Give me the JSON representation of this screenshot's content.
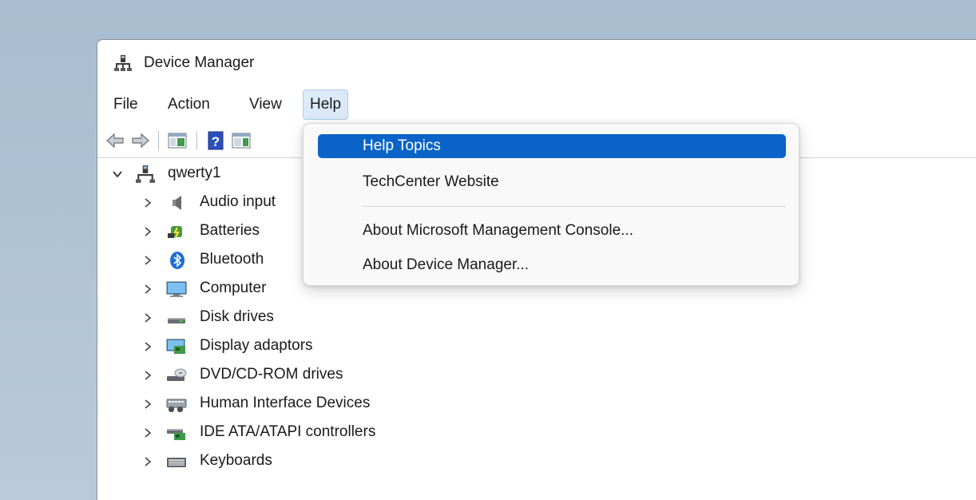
{
  "window": {
    "title": "Device Manager"
  },
  "menu": {
    "items": [
      {
        "label": "File"
      },
      {
        "label": "Action"
      },
      {
        "label": "View"
      },
      {
        "label": "Help"
      }
    ],
    "active": "Help"
  },
  "toolbar": {
    "buttons": [
      "back-icon",
      "forward-icon",
      "show-hide-console-tree-icon",
      "help-icon",
      "properties-icon"
    ]
  },
  "tree": {
    "root": {
      "label": "qwerty1",
      "icon": "computer-network-icon",
      "expanded": true
    },
    "children": [
      {
        "label": "Audio inputs and outputs",
        "visible_label": "Audio input",
        "icon": "speaker-icon"
      },
      {
        "label": "Batteries",
        "icon": "battery-icon"
      },
      {
        "label": "Bluetooth",
        "icon": "bluetooth-icon"
      },
      {
        "label": "Computer",
        "icon": "monitor-icon"
      },
      {
        "label": "Disk drives",
        "icon": "disk-drive-icon"
      },
      {
        "label": "Display adaptors",
        "icon": "display-adapter-icon"
      },
      {
        "label": "DVD/CD-ROM drives",
        "icon": "dvd-drive-icon"
      },
      {
        "label": "Human Interface Devices",
        "icon": "hid-icon"
      },
      {
        "label": "IDE ATA/ATAPI controllers",
        "icon": "ide-controller-icon"
      },
      {
        "label": "Keyboards",
        "icon": "keyboard-icon"
      }
    ]
  },
  "help_menu": {
    "items": [
      {
        "label": "Help Topics",
        "selected": true
      },
      {
        "label": "TechCenter Website"
      },
      {
        "label": "About Microsoft Management Console..."
      },
      {
        "label": "About Device Manager..."
      }
    ]
  },
  "colors": {
    "selection": "#0a64c8",
    "menu_active_bg": "#dbe9f8",
    "desktop": "#b3c6d8"
  }
}
